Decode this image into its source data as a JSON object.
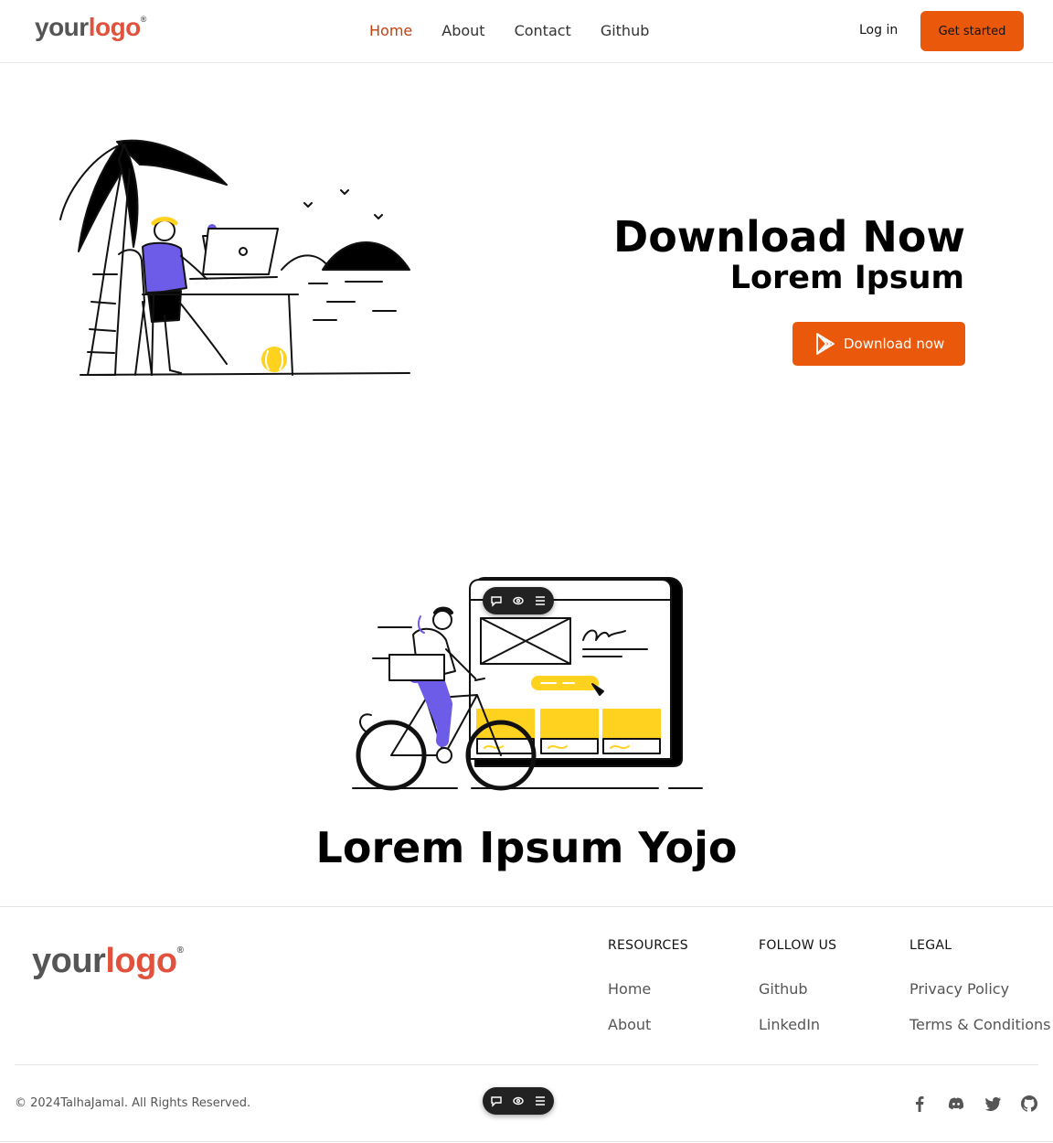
{
  "header": {
    "logo": {
      "word1": "your",
      "word2": "logo",
      "mark": "®"
    },
    "nav": [
      {
        "label": "Home",
        "active": true
      },
      {
        "label": "About",
        "active": false
      },
      {
        "label": "Contact",
        "active": false
      },
      {
        "label": "Github",
        "active": false
      }
    ],
    "login_label": "Log in",
    "cta_label": "Get started"
  },
  "hero": {
    "title": "Download Now",
    "subtitle": "Lorem Ipsum",
    "button_label": "Download now",
    "button_icon": "play-store-icon",
    "illustration": "person-working-on-laptop-under-palm-tree"
  },
  "section2": {
    "title": "Lorem Ipsum Yojo",
    "illustration": "person-riding-bicycle-with-website-wireframe"
  },
  "footer": {
    "logo": {
      "word1": "your",
      "word2": "logo",
      "mark": "®"
    },
    "columns": [
      {
        "heading": "RESOURCES",
        "links": [
          "Home",
          "About"
        ]
      },
      {
        "heading": "FOLLOW US",
        "links": [
          "Github",
          "LinkedIn"
        ]
      },
      {
        "heading": "LEGAL",
        "links": [
          "Privacy Policy",
          "Terms & Conditions"
        ]
      }
    ],
    "copyright": "© 2024TalhaJamal. All Rights Reserved.",
    "socials": [
      "facebook-icon",
      "discord-icon",
      "twitter-icon",
      "github-icon"
    ]
  },
  "toolbar_icons": [
    "comment-icon",
    "eye-icon",
    "list-icon"
  ],
  "colors": {
    "accent": "#ea580c",
    "active_nav": "#c2410c",
    "illus_purple": "#6c5ce7",
    "illus_yellow": "#ffd21f"
  }
}
